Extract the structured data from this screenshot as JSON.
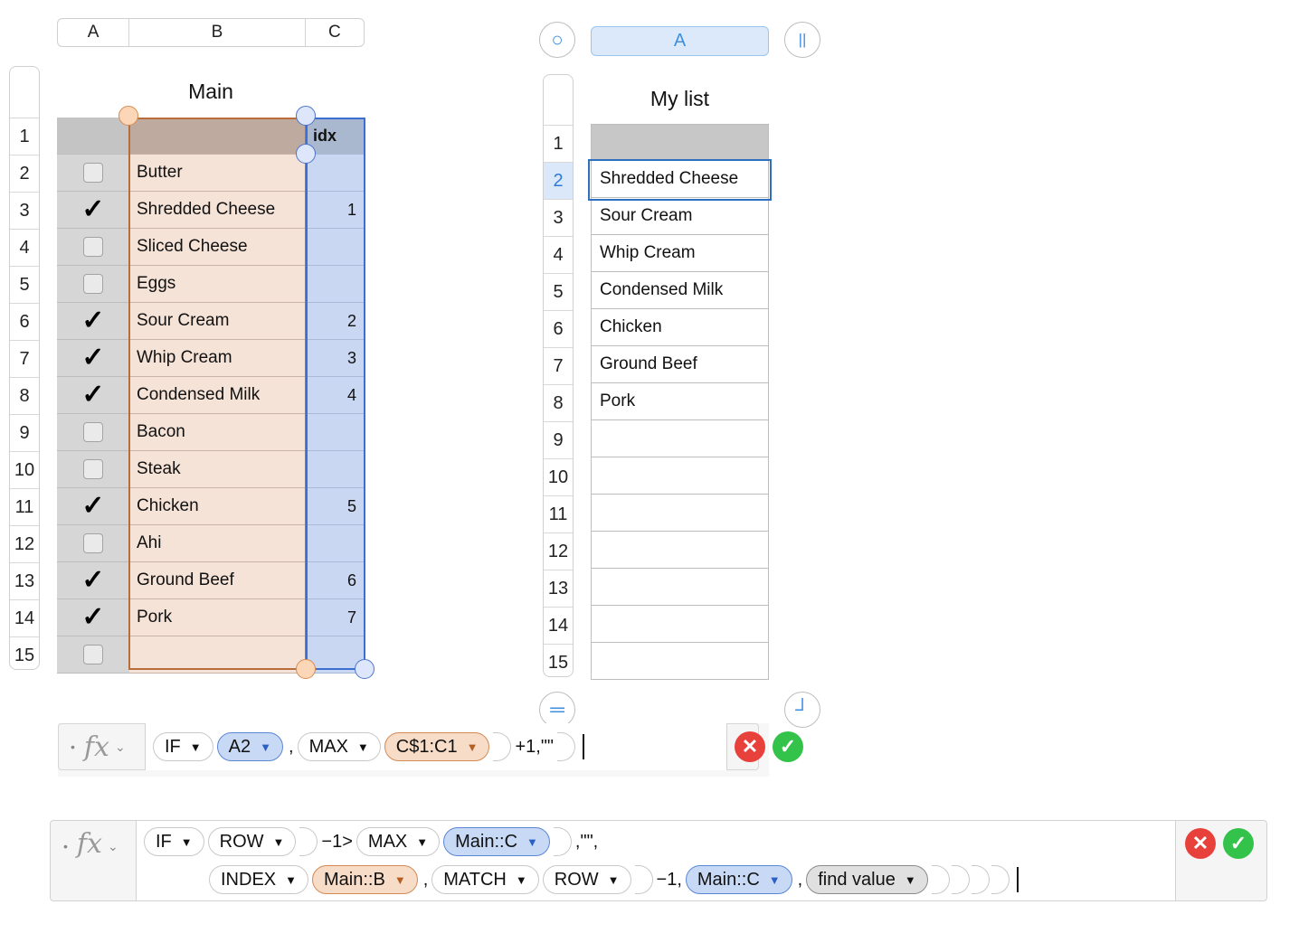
{
  "main": {
    "columns": [
      "A",
      "B",
      "C"
    ],
    "title": "Main",
    "header_c": "idx",
    "row_numbers": [
      "1",
      "2",
      "3",
      "4",
      "5",
      "6",
      "7",
      "8",
      "9",
      "10",
      "11",
      "12",
      "13",
      "14",
      "15"
    ],
    "rows": [
      {
        "item": "Butter",
        "checked": false,
        "idx": ""
      },
      {
        "item": "Shredded Cheese",
        "checked": true,
        "idx": "1"
      },
      {
        "item": "Sliced Cheese",
        "checked": false,
        "idx": ""
      },
      {
        "item": "Eggs",
        "checked": false,
        "idx": ""
      },
      {
        "item": "Sour Cream",
        "checked": true,
        "idx": "2"
      },
      {
        "item": "Whip Cream",
        "checked": true,
        "idx": "3"
      },
      {
        "item": "Condensed Milk",
        "checked": true,
        "idx": "4"
      },
      {
        "item": "Bacon",
        "checked": false,
        "idx": ""
      },
      {
        "item": "Steak",
        "checked": false,
        "idx": ""
      },
      {
        "item": "Chicken",
        "checked": true,
        "idx": "5"
      },
      {
        "item": "Ahi",
        "checked": false,
        "idx": ""
      },
      {
        "item": "Ground Beef",
        "checked": true,
        "idx": "6"
      },
      {
        "item": "Pork",
        "checked": true,
        "idx": "7"
      },
      {
        "item": "",
        "checked": false,
        "idx": ""
      }
    ],
    "check_glyph": "✓"
  },
  "mylist": {
    "column": "A",
    "title": "My list",
    "row_numbers": [
      "1",
      "2",
      "3",
      "4",
      "5",
      "6",
      "7",
      "8",
      "9",
      "10",
      "11",
      "12",
      "13",
      "14",
      "15"
    ],
    "selected_row": "2",
    "rows": [
      "Shredded Cheese",
      "Sour Cream",
      "Whip Cream",
      "Condensed Milk",
      "Chicken",
      "Ground Beef",
      "Pork",
      "",
      "",
      "",
      "",
      "",
      "",
      ""
    ]
  },
  "icons": {
    "circle": "○",
    "pause": "||",
    "equals": "═",
    "corner": "┘",
    "chevron": "⌄",
    "dot": "•",
    "fx": "fx",
    "tri": "▼",
    "cancel": "✕",
    "accept": "✓"
  },
  "formula1": {
    "t1": "IF",
    "t2": "A2",
    "lit1": ",",
    "t3": "MAX",
    "t4": "C$1:C1",
    "lit2": "+1,\"\""
  },
  "formula2": {
    "t1": "IF",
    "t2": "ROW",
    "lit1": "−1>",
    "t3": "MAX",
    "t4": "Main::C",
    "lit2": ",\"\",",
    "t5": "INDEX",
    "t6": "Main::B",
    "lit3": ",",
    "t7": "MATCH",
    "t8": "ROW",
    "lit4": "−1,",
    "t9": "Main::C",
    "lit5": ",",
    "t10": "find value"
  }
}
